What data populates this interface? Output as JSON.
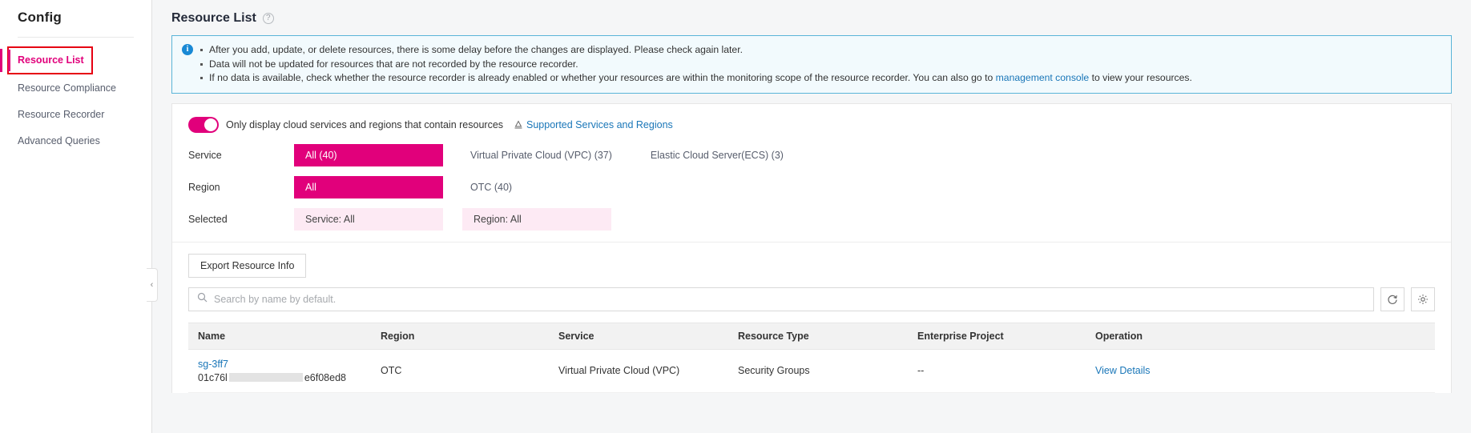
{
  "sidebar": {
    "title": "Config",
    "items": [
      {
        "label": "Resource List",
        "active": true
      },
      {
        "label": "Resource Compliance",
        "active": false
      },
      {
        "label": "Resource Recorder",
        "active": false
      },
      {
        "label": "Advanced Queries",
        "active": false
      }
    ],
    "collapse_icon": "‹"
  },
  "header": {
    "title": "Resource List",
    "help_icon": "?"
  },
  "notice": {
    "icon": "i",
    "bullets": [
      "After you add, update, or delete resources, there is some delay before the changes are displayed. Please check again later.",
      "Data will not be updated for resources that are not recorded by the resource recorder.",
      "If no data is available, check whether the resource recorder is already enabled or whether your resources are within the monitoring scope of the resource recorder. You can also go to"
    ],
    "link_text": "management console",
    "tail_text": "to view your resources."
  },
  "filters": {
    "toggle_label": "Only display cloud services and regions that contain resources",
    "toggle_on": true,
    "supported_link": "Supported Services and Regions",
    "service": {
      "label": "Service",
      "options": [
        {
          "label": "All (40)",
          "selected": true
        },
        {
          "label": "Virtual Private Cloud (VPC) (37)",
          "selected": false
        },
        {
          "label": "Elastic Cloud Server(ECS) (3)",
          "selected": false
        }
      ]
    },
    "region": {
      "label": "Region",
      "options": [
        {
          "label": "All",
          "selected": true
        },
        {
          "label": "OTC (40)",
          "selected": false
        }
      ]
    },
    "selected": {
      "label": "Selected",
      "tags": [
        "Service: All",
        "Region: All"
      ]
    }
  },
  "toolbar": {
    "export_label": "Export Resource Info"
  },
  "search": {
    "placeholder": "Search by name by default.",
    "value": "",
    "search_icon": "search-icon",
    "refresh_icon": "refresh-icon",
    "settings_icon": "gear-icon"
  },
  "table": {
    "columns": [
      "Name",
      "Region",
      "Service",
      "Resource Type",
      "Enterprise Project",
      "Operation"
    ],
    "rows": [
      {
        "name": "sg-3ff7",
        "id_prefix": "01c76l",
        "id_suffix": "e6f08ed8",
        "region": "OTC",
        "service": "Virtual Private Cloud (VPC)",
        "resource_type": "Security Groups",
        "enterprise_project": "--",
        "operation": "View Details"
      }
    ]
  },
  "colors": {
    "accent": "#e1007b",
    "link": "#1976b8",
    "notice_border": "#5ab4d8",
    "notice_bg": "#f2fafd",
    "highlight_box": "#e60012"
  }
}
